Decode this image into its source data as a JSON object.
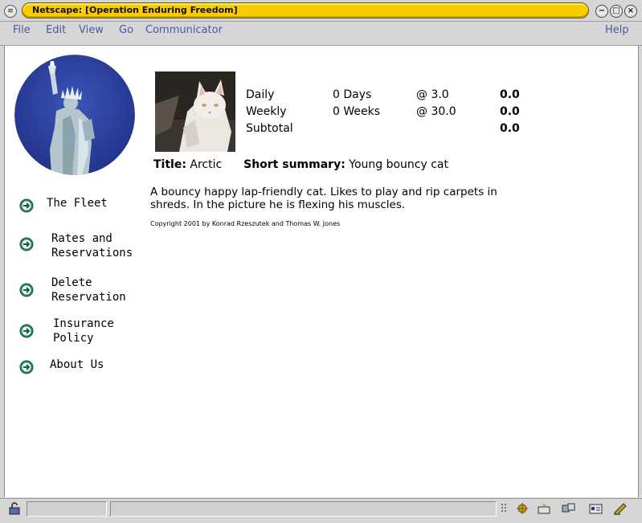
{
  "window": {
    "title": "Netscape: [Operation Enduring Freedom]"
  },
  "menu": {
    "file": "File",
    "edit": "Edit",
    "view": "View",
    "go": "Go",
    "communicator": "Communicator",
    "help": "Help"
  },
  "nav": {
    "fleet": "The Fleet",
    "rates": "Rates and\nReservations",
    "delete": "Delete\nReservation",
    "insurance": "Insurance\nPolicy",
    "about": "About Us"
  },
  "rates": {
    "daily": {
      "label": "Daily",
      "qty": "0 Days",
      "rate": "@ 3.0",
      "total": "0.0"
    },
    "weekly": {
      "label": "Weekly",
      "qty": "0 Weeks",
      "rate": "@ 30.0",
      "total": "0.0"
    },
    "subtotal": {
      "label": "Subtotal",
      "total": "0.0"
    }
  },
  "item": {
    "title_label": "Title:",
    "title_value": "Arctic",
    "summary_label": "Short summary:",
    "summary_value": "Young bouncy cat",
    "description": "A bouncy happy lap-friendly cat. Likes to play and rip carpets in shreds. In the picture he is flexing his muscles."
  },
  "footer": {
    "copyright": "Copyright 2001 by Konrad Rzeszutek and Thomas W. Jones"
  },
  "colors": {
    "title_pill": "#f8cc00",
    "menu_text": "#4a5aa0",
    "nav_arrow": "#2a8a6a"
  },
  "icons": {
    "system_menu": "system-menu-icon",
    "minimize": "minimize-icon",
    "maximize": "maximize-icon",
    "close": "close-icon",
    "nav_arrow": "arrow-circle-icon",
    "security": "lock-icon"
  }
}
